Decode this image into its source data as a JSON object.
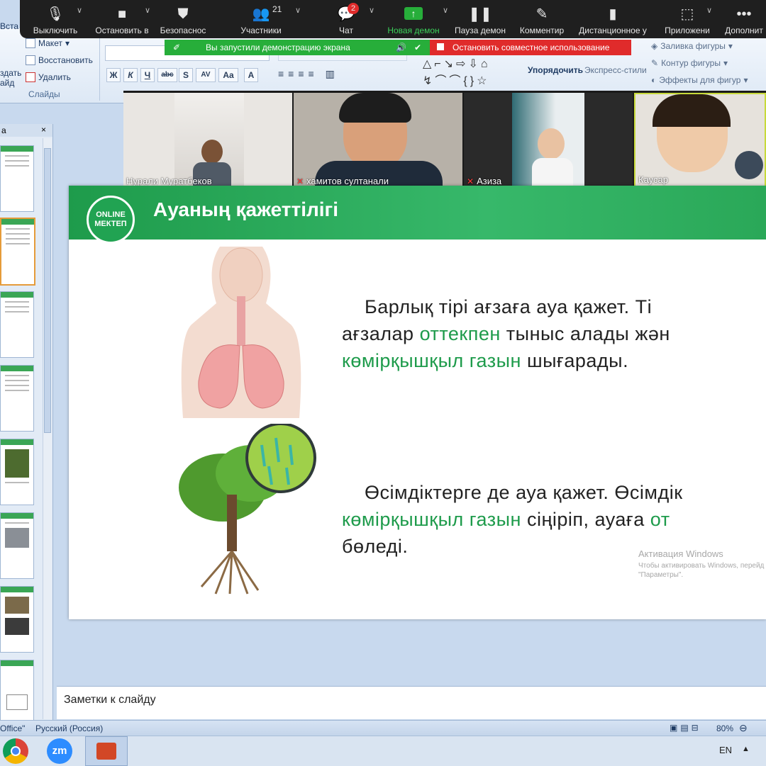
{
  "zoom_toolbar": {
    "items": [
      {
        "label": "Выключить",
        "icon": "mic-icon"
      },
      {
        "label": "Остановить в",
        "icon": "video-icon"
      },
      {
        "label": "Безопаснос",
        "icon": "shield-icon"
      },
      {
        "label": "Участники",
        "icon": "participants-icon",
        "count": "21"
      },
      {
        "label": "Чат",
        "icon": "chat-icon",
        "badge": "2"
      },
      {
        "label": "Новая демон",
        "icon": "share-screen-icon"
      },
      {
        "label": "Пауза демон",
        "icon": "pause-icon"
      },
      {
        "label": "Комментир",
        "icon": "annotate-icon"
      },
      {
        "label": "Дистанционное у",
        "icon": "remote-control-icon"
      },
      {
        "label": "Приложени",
        "icon": "apps-icon"
      },
      {
        "label": "Дополнит",
        "icon": "more-icon"
      }
    ],
    "share_notice": "Вы запустили демонстрацию экрана",
    "stop_share": "Остановить совместное использование",
    "accent_green": "#27ae3a",
    "accent_red": "#e02b2b"
  },
  "ribbon": {
    "insert_partial": "Вста",
    "create_slide_partial": "здать\nайд",
    "layout": "Макет",
    "reset": "Восстановить",
    "delete": "Удалить",
    "group_slides": "Слайды",
    "format_buttons": [
      "Ж",
      "К",
      "Ч",
      "abc",
      "S",
      "AV",
      "Aa",
      "A"
    ],
    "arrange": "Упорядочить",
    "quick_styles": "Экспресс-стили",
    "shape_fill": "Заливка фигуры",
    "shape_outline": "Контур фигуры",
    "shape_effects": "Эффекты для фигур"
  },
  "slides_panel": {
    "tab_partial": "а",
    "close": "×",
    "thumb_count": 8
  },
  "participants": [
    {
      "name": "Нурали Муратбеков",
      "muted": false
    },
    {
      "name": "хамитов султанали",
      "muted": true
    },
    {
      "name": "Азиза",
      "muted": true
    },
    {
      "name": "Каусар",
      "muted": false
    }
  ],
  "slide": {
    "logo_line1": "ONLINE",
    "logo_line2": "МЕКТЕП",
    "title": "Ауаның қажеттілігі",
    "para1": {
      "l1": "Барлық  тірі  ағзаға  ауа  қажет.  Ті",
      "l2a": "ағзалар  ",
      "l2g": "оттекпен",
      "l2b": "  тыныс  алады  жән",
      "l3g": "көмірқышқыл газын",
      "l3b": " шығарады."
    },
    "para2": {
      "l1": "Өсімдіктерге  де  ауа  қажет.  Өсімдік",
      "l2g": "көмірқышқыл  газын",
      "l2b": "  сіңіріп,    ауаға  ",
      "l2g2": "от",
      "l3": "бөледі."
    },
    "activation_title": "Активация Windows",
    "activation_text1": "Чтобы активировать Windows, перейд",
    "activation_text2": "\"Параметры\"."
  },
  "notes_placeholder": "Заметки к слайду",
  "status": {
    "theme": "Office\"",
    "language": "Русский (Россия)",
    "zoom": "80%"
  },
  "taskbar": {
    "lang": "EN",
    "apps": [
      "chrome-icon",
      "zoom-icon",
      "powerpoint-icon"
    ]
  }
}
